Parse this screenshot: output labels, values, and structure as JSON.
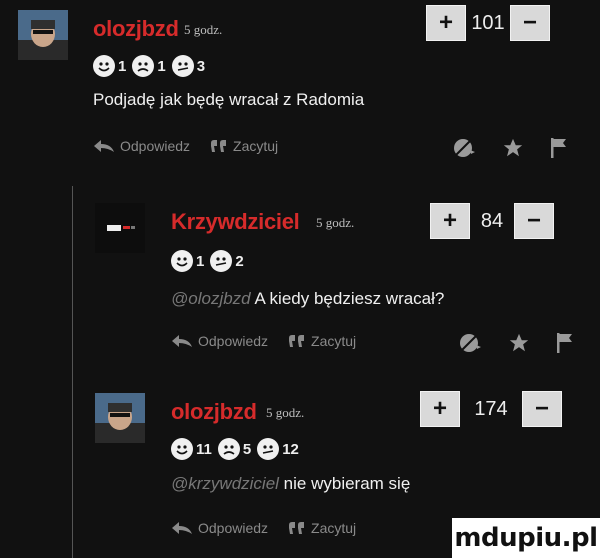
{
  "comments": [
    {
      "username": "olozjbzd",
      "time": "5 godz.",
      "votes": "101",
      "reactions": [
        {
          "icon": "smiley-icon",
          "count": "1"
        },
        {
          "icon": "sad-icon",
          "count": "1"
        },
        {
          "icon": "neutral-icon",
          "count": "3"
        }
      ],
      "text": "Podjadę jak będę wracał z Radomia",
      "mention": ""
    },
    {
      "username": "Krzywdziciel",
      "time": "5 godz.",
      "votes": "84",
      "reactions": [
        {
          "icon": "smiley-icon",
          "count": "1"
        },
        {
          "icon": "neutral-icon",
          "count": "2"
        }
      ],
      "mention": "@olozjbzd",
      "text": "A kiedy będziesz wracał?"
    },
    {
      "username": "olozjbzd",
      "time": "5 godz.",
      "votes": "174",
      "reactions": [
        {
          "icon": "smiley-icon",
          "count": "11"
        },
        {
          "icon": "sad-icon",
          "count": "5"
        },
        {
          "icon": "neutral-icon",
          "count": "12"
        }
      ],
      "mention": "@krzywdziciel",
      "text": "nie wybieram się"
    }
  ],
  "actions": {
    "reply": "Odpowiedz",
    "quote": "Zacytuj",
    "plus": "+",
    "minus": "−"
  },
  "colors": {
    "username": "#d62b2b",
    "background": "#111111",
    "vote_button": "#d9d9d9"
  },
  "watermark": "mdupiu.pl"
}
